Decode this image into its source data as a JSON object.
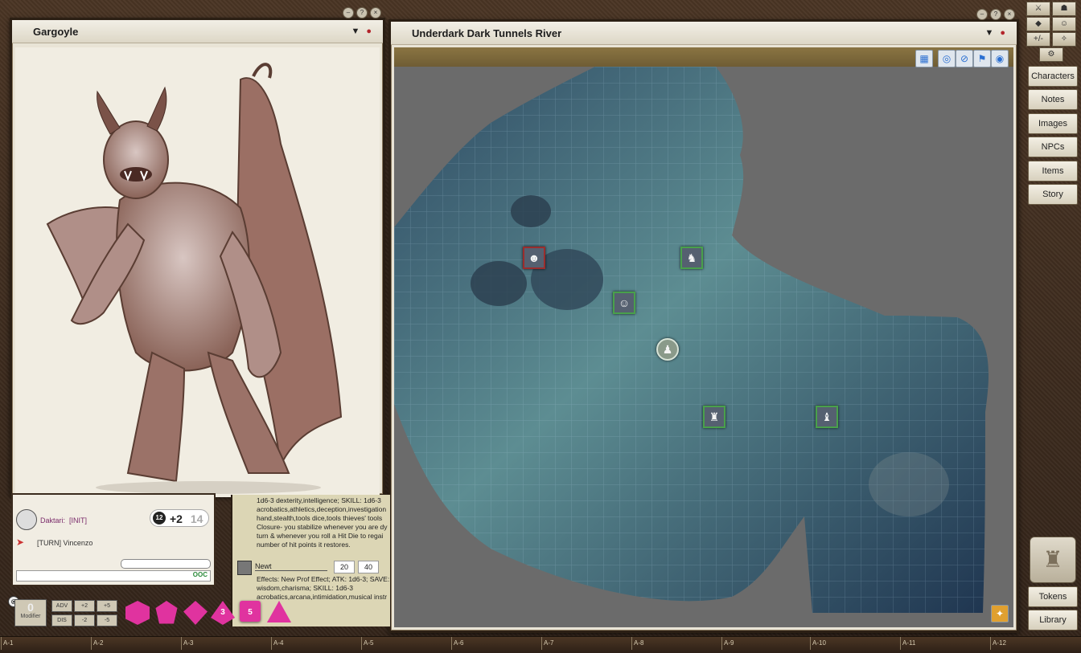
{
  "image_window": {
    "title": "Gargoyle"
  },
  "map_window": {
    "title": "Underdark Dark Tunnels River"
  },
  "sidebar": {
    "buttons": [
      "Characters",
      "Notes",
      "Images",
      "NPCs",
      "Items",
      "Story"
    ],
    "bottom_buttons": [
      "Tokens",
      "Library"
    ],
    "top_icons": [
      "+/-"
    ]
  },
  "chat": {
    "init_name": "Daktari:",
    "init_tag": "[INIT]",
    "turn_text": "[TURN] Vincenzo",
    "ooc_label": "OOC",
    "init_modifier": "+2",
    "init_total": "14",
    "init_die": "12"
  },
  "combat_tracker": {
    "entry1_text": "1d6-3 dexterity,intelligence; SKILL: 1d6-3 acrobatics,athletics,deception,investigation hand,stealth,tools dice,tools thieves' tools Closure- you stabilize whenever you are dy turn & whenever you roll a Hit Die to regai number of hit points it restores.",
    "entry2_name": "Newt",
    "entry2_val1": "20",
    "entry2_val2": "40",
    "entry2_text": "Effects: New Prof Effect; ATK: 1d6-3; SAVE: wisdom,charisma; SKILL: 1d6-3 acrobatics,arcana,intimidation,musical instr"
  },
  "dice_tray": {
    "modifier_value": "0",
    "modifier_label": "Modifier",
    "adv_label": "ADV",
    "dis_label": "DIS",
    "plus2": "+2",
    "plus5": "+5",
    "minus2": "-2",
    "minus5": "-5",
    "dice": [
      "d20",
      "d12",
      "d10",
      "3",
      "5",
      "d4"
    ]
  },
  "ruler": {
    "labels": [
      "A-1",
      "A-2",
      "A-3",
      "A-4",
      "A-5",
      "A-6",
      "A-7",
      "A-8",
      "A-9",
      "A-10",
      "A-11",
      "A-12"
    ]
  },
  "colors": {
    "dice": "#e0339f",
    "token_border": "#49a04b",
    "token_border_hostile": "#9a2d2d"
  }
}
